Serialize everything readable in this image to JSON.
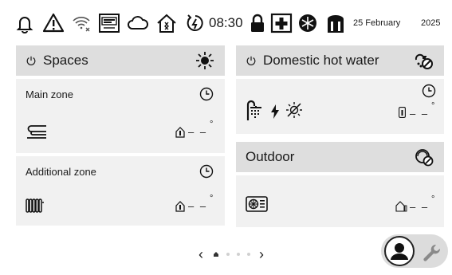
{
  "status_bar": {
    "icons": [
      "bell-icon",
      "warning-icon",
      "wifi-off-icon",
      "gateway-icon",
      "cloud-icon",
      "home-signal-icon",
      "timer-icon"
    ],
    "time": "08:30",
    "icons_right": [
      "lock-icon",
      "first-aid-icon",
      "defrost-icon",
      "cylinder-icon"
    ],
    "date": "25 February",
    "year": "2025"
  },
  "spaces": {
    "title": "Spaces",
    "header_icon": "sun-icon",
    "zones": [
      {
        "label": "Main zone",
        "emitter_icon": "underfloor-heating-icon",
        "temp": "– –",
        "unit": "°"
      },
      {
        "label": "Additional zone",
        "emitter_icon": "radiator-icon",
        "temp": "– –",
        "unit": "°"
      }
    ]
  },
  "dhw": {
    "title": "Domestic hot water",
    "header_icon": "dhw-disabled-icon",
    "temp": "– –",
    "unit": "°"
  },
  "outdoor": {
    "title": "Outdoor",
    "header_icon": "outdoor-disabled-icon",
    "temp": "– –",
    "unit": "°"
  },
  "pager": {
    "prev": "‹",
    "next": "›",
    "pages": 4,
    "active": 0
  }
}
